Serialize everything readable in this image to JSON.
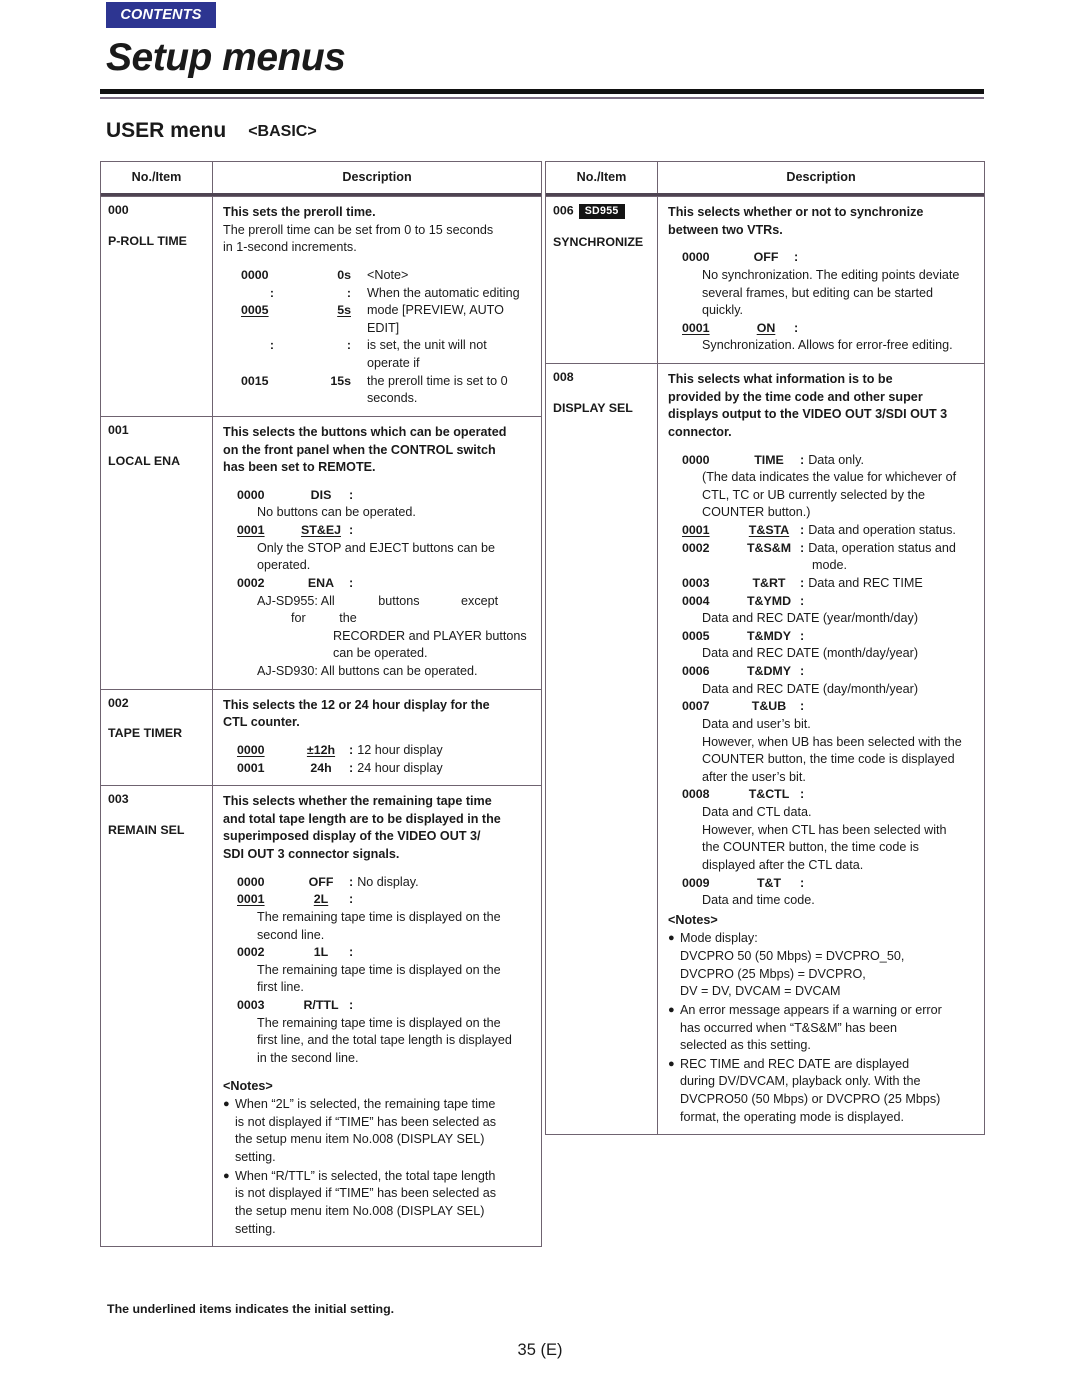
{
  "header": {
    "contents_tab": "CONTENTS",
    "title": "Setup menus",
    "section_title": "USER menu",
    "section_sub": "<BASIC>"
  },
  "table_headers": {
    "no_item": "No./Item",
    "description": "Description"
  },
  "left_table": {
    "rows": [
      {
        "num": "000",
        "item": "P-ROLL TIME",
        "lead": "This sets the preroll time.",
        "body1": "The preroll time can be set from 0 to 15 seconds",
        "body2": "in 1-second increments.",
        "preroll": [
          {
            "a": "0000",
            "b": "0s",
            "c": "<Note>"
          },
          {
            "a": ":",
            "b": ":",
            "c": "When  the  automatic  editing"
          },
          {
            "a": "0005",
            "b": "5s",
            "c": "mode [PREVIEW, AUTO EDIT]"
          },
          {
            "a": ":",
            "b": ":",
            "c": "is set, the unit will not operate if"
          },
          {
            "a": "0015",
            "b": "15s",
            "c": "the  preroll  time  is  set  to  0"
          },
          {
            "a": "",
            "b": "",
            "c": "seconds."
          }
        ]
      },
      {
        "num": "001",
        "item": "LOCAL ENA",
        "lead1": "This selects the buttons which can be operated",
        "lead2": "on the front panel when the CONTROL switch",
        "lead3": "has been set to REMOTE.",
        "opt_0000_code": "0000",
        "opt_0000_label": "DIS",
        "opt_0000_text": "No buttons can be operated.",
        "opt_0001_code": "0001",
        "opt_0001_label": "ST&EJ",
        "opt_0001_text1": "Only  the  STOP  and  EJECT  buttons  can  be",
        "opt_0001_text2": "operated.",
        "opt_0002_code": "0002",
        "opt_0002_label": "ENA",
        "opt_0002_l1a": "AJ-SD955: All",
        "opt_0002_l1b": "buttons",
        "opt_0002_l1c": "except",
        "opt_0002_l1d": "for",
        "opt_0002_l1e": "the",
        "opt_0002_l2": "RECORDER and PLAYER buttons",
        "opt_0002_l3": "can be operated.",
        "opt_0002_l4": "AJ-SD930: All buttons can be operated."
      },
      {
        "num": "002",
        "item": "TAPE TIMER",
        "lead1": "This selects the 12 or 24 hour display for the",
        "lead2": "CTL counter.",
        "opt_a_code": "0000",
        "opt_a_label": "±12h",
        "opt_a_text": "12 hour display",
        "opt_b_code": "0001",
        "opt_b_label": "24h",
        "opt_b_text": "24 hour display"
      },
      {
        "num": "003",
        "item": "REMAIN SEL",
        "lead1": "This selects whether the remaining tape time",
        "lead2": "and total tape length are to be displayed in the",
        "lead3": "superimposed  display  of  the  VIDEO  OUT  3/",
        "lead4": "SDI OUT 3 connector signals.",
        "opt_0000_code": "0000",
        "opt_0000_label": "OFF",
        "opt_0000_text": "No display.",
        "opt_0001_code": "0001",
        "opt_0001_label": "2L",
        "opt_0001_t1": "The remaining tape time is displayed on the",
        "opt_0001_t2": "second line.",
        "opt_0002_code": "0002",
        "opt_0002_label": "1L",
        "opt_0002_t1": "The  remaining  tape  time  is  displayed  on  the",
        "opt_0002_t2": "first line.",
        "opt_0003_code": "0003",
        "opt_0003_label": "R/TTL",
        "opt_0003_t1": "The  remaining  tape  time  is  displayed  on  the",
        "opt_0003_t2": "first  line,  and  the  total  tape  length  is  displayed",
        "opt_0003_t3": "in the second line.",
        "notes_head": "<Notes>",
        "note1_l1": "When “2L” is selected, the remaining tape time",
        "note1_l2": "is  not  displayed  if  “TIME”  has  been  selected  as",
        "note1_l3": "the setup menu item No.008 (DISPLAY SEL)",
        "note1_l4": "setting.",
        "note2_l1": "When “R/TTL” is selected, the total tape length",
        "note2_l2": "is  not  displayed  if  “TIME”  has  been  selected  as",
        "note2_l3": "the setup menu item No.008 (DISPLAY SEL)",
        "note2_l4": "setting."
      }
    ]
  },
  "right_table": {
    "rows": [
      {
        "num": "006",
        "badge": "SD955",
        "item": "SYNCHRONIZE",
        "lead1": "This selects whether or not to synchronize",
        "lead2": "between two VTRs.",
        "opt_0000_code": "0000",
        "opt_0000_label": "OFF",
        "opt_0000_t1": "No synchronization.  The editing points deviate",
        "opt_0000_t2": "several  frames,  but  editing  can  be  started",
        "opt_0000_t3": "quickly.",
        "opt_0001_code": "0001",
        "opt_0001_label": "ON",
        "opt_0001_t1": "Synchronization.  Allows for error-free editing."
      },
      {
        "num": "008",
        "item": "DISPLAY SEL",
        "lead1": "This selects what information is to be",
        "lead2": "provided by the time code and other super",
        "lead3": "displays output to the VIDEO OUT 3/SDI OUT 3",
        "lead4": "connector.",
        "o0_code": "0000",
        "o0_label": "TIME",
        "o0_text": "Data only.",
        "o0_t1": "(The data indicates the value for whichever of",
        "o0_t2": "CTL,  TC  or  UB  currently  selected  by  the",
        "o0_t3": "COUNTER button.)",
        "o1_code": "0001",
        "o1_label": "T&STA",
        "o1_text": "Data and operation status.",
        "o2_code": "0002",
        "o2_label": "T&S&M",
        "o2_text": "Data,    operation    status    and",
        "o2_t2": "mode.",
        "o3_code": "0003",
        "o3_label": "T&RT",
        "o3_text": "Data and REC TIME",
        "o4_code": "0004",
        "o4_label": "T&YMD",
        "o4_t1": "Data and REC DATE (year/month/day)",
        "o5_code": "0005",
        "o5_label": "T&MDY",
        "o5_t1": "Data and REC DATE (month/day/year)",
        "o6_code": "0006",
        "o6_label": "T&DMY",
        "o6_t1": "Data and REC DATE (day/month/year)",
        "o7_code": "0007",
        "o7_label": "T&UB",
        "o7_t1": "Data and user’s bit.",
        "o7_t2": "However, when UB has been selected with the",
        "o7_t3": "COUNTER button, the time code is displayed",
        "o7_t4": "after the user’s bit.",
        "o8_code": "0008",
        "o8_label": "T&CTL",
        "o8_t1": "Data and CTL data.",
        "o8_t2": "However,  when  CTL  has  been  selected  with",
        "o8_t3": "the  COUNTER  button,  the  time  code  is",
        "o8_t4": "displayed after the CTL data.",
        "o9_code": "0009",
        "o9_label": "T&T",
        "o9_t1": "Data and time code.",
        "notes_head": "<Notes>",
        "note1_l1": "Mode display:",
        "note1_l2": "DVCPRO 50 (50 Mbps) = DVCPRO_50,",
        "note1_l3": "DVCPRO (25 Mbps) = DVCPRO,",
        "note1_l4": "DV = DV, DVCAM = DVCAM",
        "note2_l1": "An error message appears if a warning or error",
        "note2_l2": "has   occurred   when   “T&S&M”   has   been",
        "note2_l3": "selected as this setting.",
        "note3_l1": "REC  TIME  and  REC  DATE  are  displayed",
        "note3_l2": "during  DV/DVCAM,  playback  only.   With  the",
        "note3_l3": "DVCPRO50 (50 Mbps) or DVCPRO (25 Mbps)",
        "note3_l4": "format, the operating mode is displayed."
      }
    ]
  },
  "footer": {
    "footnote": "The underlined items indicates the initial setting.",
    "page_number": "35 (E)"
  },
  "colors": {
    "contents_tab_bg": "#2d3591",
    "badge_bg": "#141414",
    "border": "#6f6370",
    "rule_thin": "#7d6f84",
    "text": "#1a1a1a"
  }
}
